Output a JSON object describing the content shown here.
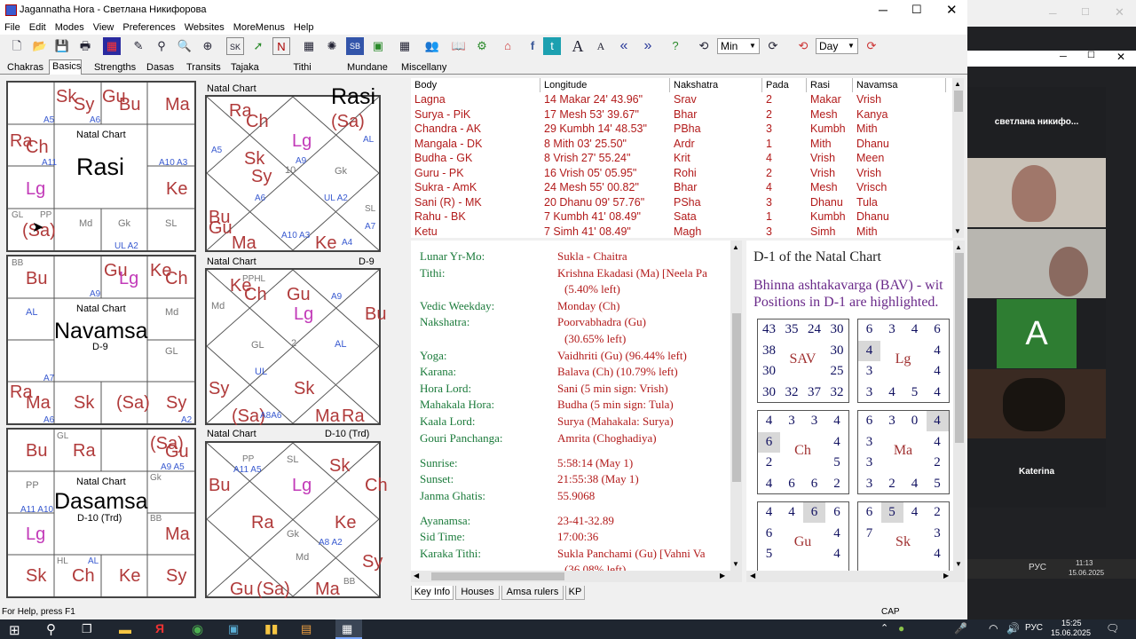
{
  "window": {
    "title": "Jagannatha Hora - Светлана Никифорова"
  },
  "menu": [
    "File",
    "Edit",
    "Modes",
    "View",
    "Preferences",
    "Websites",
    "MoreMenus",
    "Help"
  ],
  "toolbar": {
    "min_combo": "Min",
    "day_combo": "Day"
  },
  "tabs": [
    "Chakras",
    "Basics",
    "Strengths",
    "Dasas",
    "Transits",
    "Tajaka",
    "Tithi Pravesha",
    "Mundane",
    "Miscellany"
  ],
  "south_charts": [
    {
      "title": "Natal Chart",
      "name": "Rasi",
      "sub": ""
    },
    {
      "title": "Natal Chart",
      "name": "Navamsa",
      "sub": "D-9"
    },
    {
      "title": "Natal Chart",
      "name": "Dasamsa",
      "sub": "D-10 (Trd)"
    }
  ],
  "north_charts": [
    {
      "title": "Natal Chart",
      "corner": "Rasi"
    },
    {
      "title": "Natal Chart",
      "corner": "D-9"
    },
    {
      "title": "Natal Chart",
      "corner": "D-10 (Trd)"
    }
  ],
  "body_table": {
    "headers": [
      "Body",
      "Longitude",
      "Nakshatra",
      "Pada",
      "Rasi",
      "Navamsa"
    ],
    "rows": [
      [
        "Lagna",
        "14 Makar 24' 43.96\"",
        "Srav",
        "2",
        "Makar",
        "Vrish"
      ],
      [
        "Surya - PiK",
        "17 Mesh 53' 39.67\"",
        "Bhar",
        "2",
        "Mesh",
        "Kanya"
      ],
      [
        "Chandra - AK",
        "29 Kumbh 14' 48.53\"",
        "PBha",
        "3",
        "Kumbh",
        "Mith"
      ],
      [
        "Mangala - DK",
        "8 Mith 03' 25.50\"",
        "Ardr",
        "1",
        "Mith",
        "Dhanu"
      ],
      [
        "Budha - GK",
        "8 Vrish 27' 55.24\"",
        "Krit",
        "4",
        "Vrish",
        "Meen"
      ],
      [
        "Guru - PK",
        "16 Vrish 05' 05.95\"",
        "Rohi",
        "2",
        "Vrish",
        "Vrish"
      ],
      [
        "Sukra - AmK",
        "24 Mesh 55' 00.82\"",
        "Bhar",
        "4",
        "Mesh",
        "Vrisch"
      ],
      [
        "Sani (R) - MK",
        "20 Dhanu 09' 57.76\"",
        "PSha",
        "3",
        "Dhanu",
        "Tula"
      ],
      [
        "Rahu - BK",
        "7 Kumbh 41' 08.49\"",
        "Sata",
        "1",
        "Kumbh",
        "Dhanu"
      ],
      [
        "Ketu",
        "7 Simh 41' 08.49\"",
        "Magh",
        "3",
        "Simh",
        "Mith"
      ]
    ]
  },
  "key_info": [
    {
      "label": "Lunar Yr-Mo:",
      "value": "Sukla - Chaitra"
    },
    {
      "label": "Tithi:",
      "value": "Krishna Ekadasi (Ma) [Neela Pa"
    },
    {
      "label": "",
      "value": "(5.40% left)"
    },
    {
      "label": "Vedic Weekday:",
      "value": "Monday (Ch)"
    },
    {
      "label": "Nakshatra:",
      "value": "Poorvabhadra (Gu)"
    },
    {
      "label": "",
      "value": "(30.65% left)"
    },
    {
      "label": "Yoga:",
      "value": "Vaidhriti (Gu) (96.44% left)"
    },
    {
      "label": "Karana:",
      "value": "Balava (Ch) (10.79% left)"
    },
    {
      "label": "Hora Lord:",
      "value": "Sani (5 min sign: Vrish)"
    },
    {
      "label": "Mahakala Hora:",
      "value": "Budha (5 min sign: Tula)"
    },
    {
      "label": "Kaala Lord:",
      "value": "Surya (Mahakala: Surya)"
    },
    {
      "label": "Gouri Panchanga:",
      "value": "Amrita (Choghadiya)"
    },
    {
      "label": "Sunrise:",
      "value": "5:58:14 (May 1)"
    },
    {
      "label": "Sunset:",
      "value": "21:55:38 (May 1)"
    },
    {
      "label": "Janma Ghatis:",
      "value": "55.9068"
    },
    {
      "label": "Ayanamsa:",
      "value": "23-41-32.89"
    },
    {
      "label": "Sid Time:",
      "value": "17:00:36"
    },
    {
      "label": "Karaka Tithi:",
      "value": "Sukla Panchami (Gu) [Vahni Va"
    },
    {
      "label": "",
      "value": "(36.08% left)"
    }
  ],
  "bav": {
    "heading": "D-1 of the Natal Chart",
    "desc1": "Bhinna ashtakavarga (BAV) - wit",
    "desc2": "Positions in D-1 are highlighted.",
    "grids": [
      {
        "label": "SAV",
        "cells": [
          "43",
          "35",
          "24",
          "30",
          "30",
          "25",
          "32",
          "37",
          "32",
          "30",
          "30",
          "38"
        ],
        "hl": []
      },
      {
        "label": "Lg",
        "cells": [
          "6",
          "3",
          "4",
          "6",
          "4",
          "4",
          "4",
          "5",
          "4",
          "3",
          "3",
          "4"
        ],
        "hl": [
          11
        ]
      },
      {
        "label": "Ch",
        "cells": [
          "4",
          "3",
          "3",
          "4",
          "4",
          "5",
          "2",
          "6",
          "6",
          "4",
          "2",
          "6"
        ],
        "hl": [
          11
        ]
      },
      {
        "label": "Ma",
        "cells": [
          "6",
          "3",
          "0",
          "4",
          "4",
          "2",
          "5",
          "4",
          "2",
          "3",
          "3",
          "3"
        ],
        "hl": [
          3
        ]
      },
      {
        "label": "Gu",
        "cells": [
          "4",
          "4",
          "6",
          "6",
          "4",
          "4",
          "",
          "",
          "",
          "",
          "5",
          "6"
        ],
        "hl": [
          2
        ]
      },
      {
        "label": "Sk",
        "cells": [
          "6",
          "5",
          "4",
          "2",
          "3",
          "4",
          "",
          "",
          "",
          "",
          "",
          "7"
        ],
        "hl": [
          1
        ]
      }
    ]
  },
  "bottom_tabs": [
    "Key Info",
    "Houses",
    "Amsa rulers",
    "KP"
  ],
  "status": {
    "help": "For Help, press F1",
    "cap": "CAP"
  },
  "video": {
    "top_name": "светлана  никифо...",
    "tile_letter": "A",
    "bottom_name": "Katerina"
  },
  "clock": {
    "time1": "11:13",
    "date1": "15.06.2025",
    "time2": "15:25",
    "date2": "15.06.2025",
    "lang": "РУС"
  }
}
